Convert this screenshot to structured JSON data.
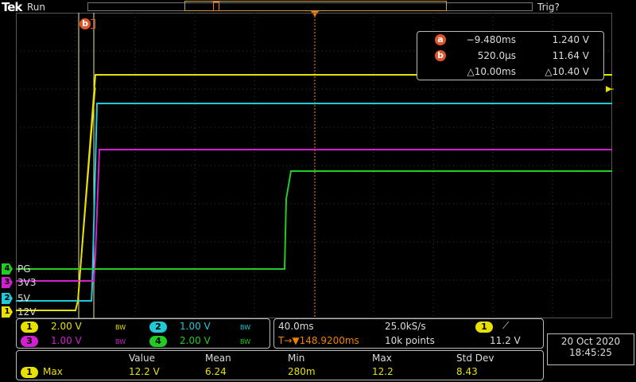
{
  "header": {
    "logo": "Tek",
    "run_status": "Run",
    "trigger_status": "Trig?"
  },
  "cursors": {
    "a": {
      "label": "a",
      "time": "−9.480ms",
      "volt": "1.240 V"
    },
    "b": {
      "label": "b",
      "time": "520.0µs",
      "volt": "11.64 V"
    },
    "delta": {
      "time": "△10.00ms",
      "volt": "△10.40 V"
    }
  },
  "channels": [
    {
      "num": "4",
      "name": "PG",
      "color": "#22cc22"
    },
    {
      "num": "3",
      "name": "3V3",
      "color": "#d020d0"
    },
    {
      "num": "2",
      "name": "5V",
      "color": "#20c8d8"
    },
    {
      "num": "1",
      "name": "12V",
      "color": "#e8e000"
    }
  ],
  "vertical": {
    "ch1": {
      "num": "1",
      "scale": "2.00 V",
      "bw": "BW",
      "color": "#e8e000"
    },
    "ch2": {
      "num": "2",
      "scale": "1.00 V",
      "bw": "BW",
      "color": "#20c8d8"
    },
    "ch3": {
      "num": "3",
      "scale": "1.00 V",
      "bw": "BW",
      "color": "#d020d0"
    },
    "ch4": {
      "num": "4",
      "scale": "2.00 V",
      "bw": "BW",
      "color": "#22cc22"
    }
  },
  "horizontal": {
    "time_scale": "40.0ms",
    "sample_rate": "25.0kS/s",
    "trigger_delay": "T→▼148.9200ms",
    "record_length": "10k points",
    "trigger_source": "1",
    "trigger_slope": "⟋",
    "trigger_level": "11.2 V"
  },
  "measurement": {
    "headers": [
      "Value",
      "Mean",
      "Min",
      "Max",
      "Std Dev"
    ],
    "source": "1",
    "name": "Max",
    "values": [
      "12.2 V",
      "6.24",
      "280m",
      "12.2",
      "8.43"
    ]
  },
  "datetime": {
    "date": "20 Oct  2020",
    "time": "18:45:25"
  },
  "colors": {
    "cursor": "#e0552a",
    "trigger": "#f08000",
    "grid": "#555555"
  },
  "icons": {
    "trigger_level_marker": "left-arrow-icon",
    "trigger_position": "down-triangle-icon"
  }
}
